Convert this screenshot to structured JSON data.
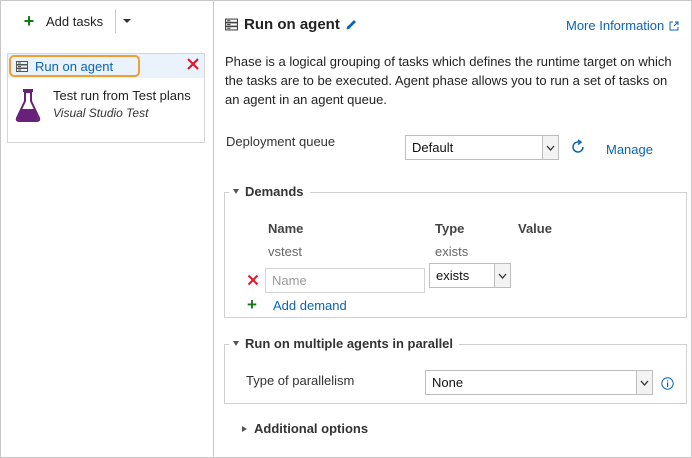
{
  "toolbar": {
    "add_tasks_label": "Add tasks"
  },
  "phase": {
    "label": "Run on agent"
  },
  "task": {
    "title": "Test run from Test plans",
    "subtitle": "Visual Studio Test"
  },
  "header": {
    "title": "Run on agent",
    "more_info": "More Information"
  },
  "description": "Phase is a logical grouping of tasks which defines the runtime target on which the tasks are to be executed. Agent phase allows you to run a set of tasks on an agent in an agent queue.",
  "deployment_queue": {
    "label": "Deployment queue",
    "value": "Default",
    "manage_label": "Manage"
  },
  "demands": {
    "title": "Demands",
    "columns": {
      "name": "Name",
      "type": "Type",
      "value": "Value"
    },
    "existing": {
      "name": "vstest",
      "type": "exists"
    },
    "new_row": {
      "name_placeholder": "Name",
      "type_value": "exists"
    },
    "add_label": "Add demand"
  },
  "parallel": {
    "title": "Run on multiple agents in parallel",
    "type_label": "Type of parallelism",
    "type_value": "None"
  },
  "additional": {
    "title": "Additional options"
  },
  "colors": {
    "link": "#0a64b4",
    "add_green": "#107c10",
    "remove_red": "#e81123",
    "selected_outline": "#f0a030",
    "vs_purple": "#68217a"
  },
  "icons": [
    "plus-icon",
    "chevron-down-icon",
    "server-icon",
    "close-icon",
    "visual-studio-test-icon",
    "pencil-icon",
    "external-link-icon",
    "refresh-icon",
    "info-icon"
  ]
}
